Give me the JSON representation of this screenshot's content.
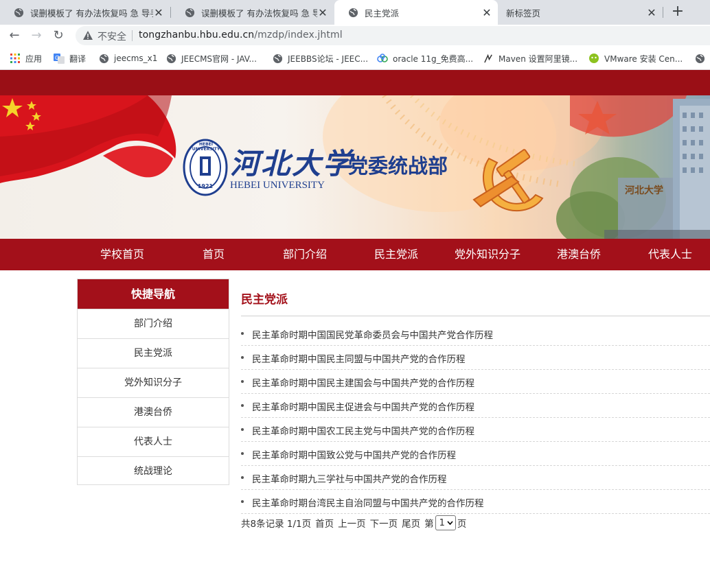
{
  "browser": {
    "tabs": [
      {
        "title": "误删模板了 有办法恢复吗 急 导手",
        "active": false
      },
      {
        "title": "误删模板了 有办法恢复吗 急 导手",
        "active": false
      },
      {
        "title": "民主党派",
        "active": true
      },
      {
        "title": "新标签页",
        "active": false
      }
    ],
    "security_label": "不安全",
    "url_host": "tongzhanbu.hbu.edu.cn",
    "url_path": "/mzdp/index.jhtml",
    "bookmarks": [
      "应用",
      "翻译",
      "jeecms_x1",
      "JEECMS官网 - JAV...",
      "JEEBBS论坛 - JEEC...",
      "oracle 11g_免费高...",
      "Maven 设置阿里镜...",
      "VMware 安装 Cen..."
    ]
  },
  "banner": {
    "university_cn": "河北大学",
    "university_en": "HEBEI UNIVERSITY",
    "seal_text": "HEBEI UNIVERSITY",
    "seal_year": "1921",
    "department": "党委统战部",
    "building_sign": "河北大学"
  },
  "nav": [
    "学校首页",
    "首页",
    "部门介绍",
    "民主党派",
    "党外知识分子",
    "港澳台侨",
    "代表人士"
  ],
  "sidebar": {
    "title": "快捷导航",
    "items": [
      "部门介绍",
      "民主党派",
      "党外知识分子",
      "港澳台侨",
      "代表人士",
      "统战理论"
    ]
  },
  "main": {
    "title": "民主党派",
    "articles": [
      "民主革命时期中国国民党革命委员会与中国共产党合作历程",
      "民主革命时期中国民主同盟与中国共产党的合作历程",
      "民主革命时期中国民主建国会与中国共产党的合作历程",
      "民主革命时期中国民主促进会与中国共产党的合作历程",
      "民主革命时期中国农工民主党与中国共产党的合作历程",
      "民主革命时期中国致公党与中国共产党的合作历程",
      "民主革命时期九三学社与中国共产党的合作历程",
      "民主革命时期台湾民主自治同盟与中国共产党的合作历程"
    ]
  },
  "pager": {
    "records": "共8条记录 1/1页",
    "first": "首页",
    "prev": "上一页",
    "next": "下一页",
    "last": "尾页",
    "go_prefix": "第",
    "page_value": "1",
    "go_suffix": "页"
  },
  "colors": {
    "brand_red": "#a3101a",
    "strip_red": "#9a0f16"
  }
}
